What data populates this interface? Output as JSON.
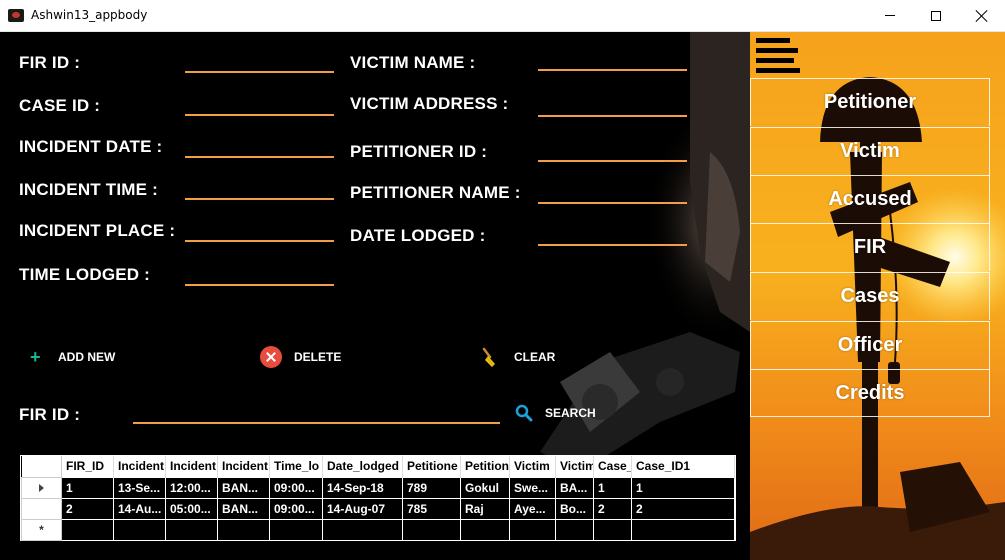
{
  "window": {
    "title": "Ashwin13_appbody"
  },
  "form": {
    "left_fields": [
      {
        "label": "FIR ID :",
        "value": ""
      },
      {
        "label": "CASE ID :",
        "value": ""
      },
      {
        "label": "INCIDENT DATE :",
        "value": ""
      },
      {
        "label": "INCIDENT TIME :",
        "value": ""
      },
      {
        "label": "INCIDENT PLACE :",
        "value": ""
      },
      {
        "label": "TIME LODGED :",
        "value": ""
      }
    ],
    "right_fields": [
      {
        "label": "VICTIM NAME :",
        "value": ""
      },
      {
        "label": "VICTIM ADDRESS :",
        "value": ""
      },
      {
        "label": "PETITIONER ID :",
        "value": ""
      },
      {
        "label": "PETITIONER NAME :",
        "value": ""
      },
      {
        "label": "DATE LODGED :",
        "value": ""
      }
    ],
    "accent_color": "#f39c4a"
  },
  "actions": {
    "add_new": "ADD NEW",
    "delete": "DELETE",
    "clear": "CLEAR",
    "search": "SEARCH"
  },
  "search": {
    "label": "FIR ID :",
    "value": ""
  },
  "grid": {
    "columns": [
      "FIR_ID",
      "Incident",
      "Incident",
      "Incident",
      "Time_lo",
      "Date_lodged",
      "Petitione",
      "Petition",
      "Victim",
      "Victim",
      "Case_",
      "Case_ID1"
    ],
    "rows": [
      [
        "1",
        "13-Se...",
        "12:00...",
        "BAN...",
        "09:00...",
        "14-Sep-18",
        "789",
        "Gokul",
        "Swe...",
        "BA...",
        "1",
        "1"
      ],
      [
        "2",
        "14-Au...",
        "05:00...",
        "BAN...",
        "09:00...",
        "14-Aug-07",
        "785",
        "Raj",
        "Aye...",
        "Bo...",
        "2",
        "2"
      ]
    ],
    "new_row_marker": "*"
  },
  "nav": {
    "items": [
      "Petitioner",
      "Victim",
      "Accused",
      "FIR",
      "Cases",
      "Officer",
      "Credits"
    ]
  }
}
